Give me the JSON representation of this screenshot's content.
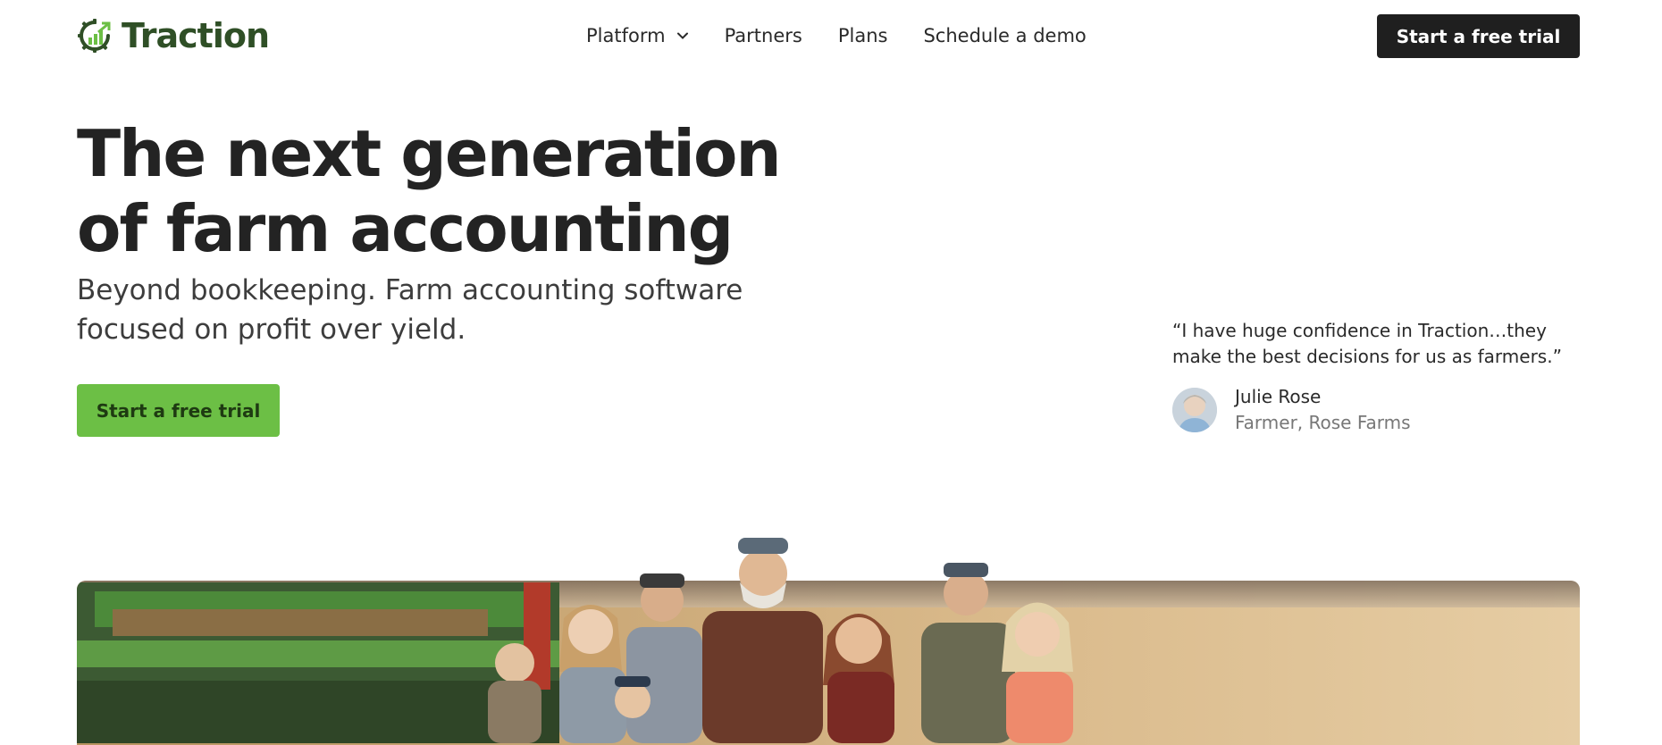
{
  "brand": {
    "name": "Traction",
    "color": "#2f4f26",
    "accent": "#6cbf45"
  },
  "nav": {
    "items": [
      {
        "label": "Platform",
        "has_dropdown": true
      },
      {
        "label": "Partners"
      },
      {
        "label": "Plans"
      },
      {
        "label": "Schedule a demo"
      }
    ],
    "cta_label": "Start a free trial"
  },
  "hero": {
    "title": "The next generation of farm accounting",
    "subtitle": "Beyond bookkeeping. Farm accounting software focused on profit over yield.",
    "cta_label": "Start a free trial"
  },
  "testimonial": {
    "quote": "“I have huge confidence in Traction…they make the best decisions for us as farmers.”",
    "author_name": "Julie Rose",
    "author_role": "Farmer, Rose Farms"
  },
  "icons": {
    "logo": "gear-chart-icon",
    "dropdown": "chevron-down-icon"
  }
}
